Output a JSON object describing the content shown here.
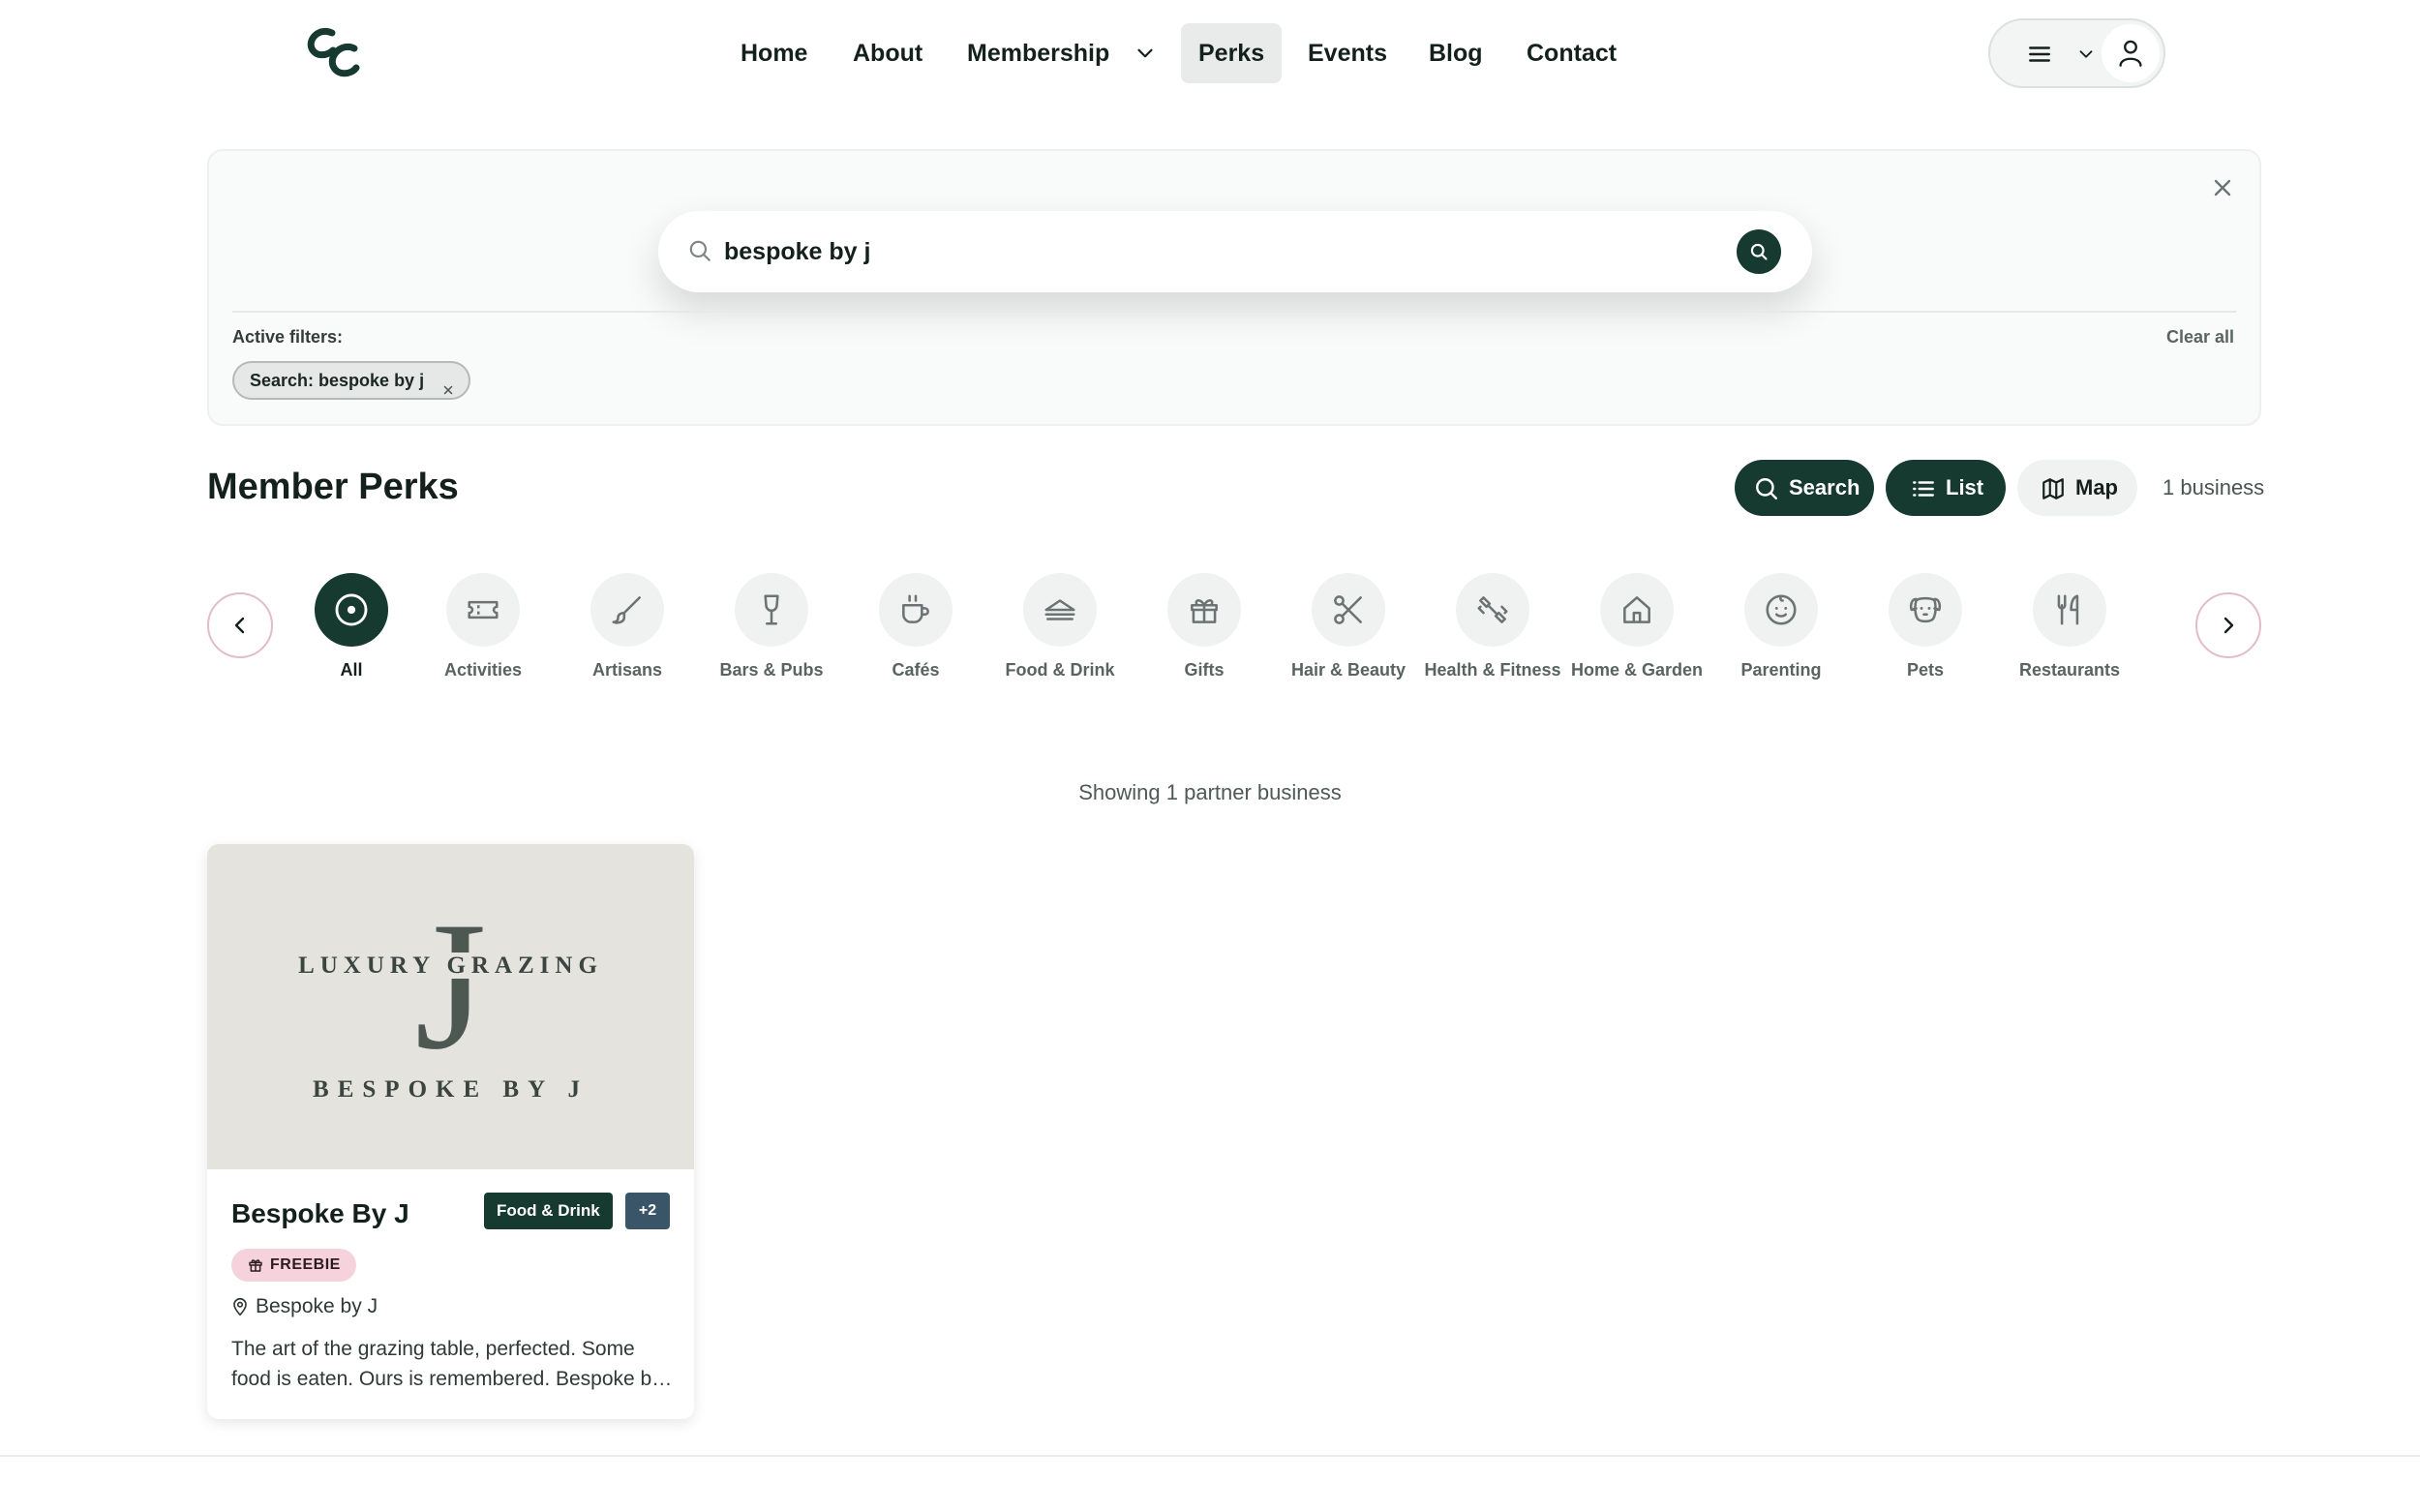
{
  "brand": {
    "logo_text": "cc"
  },
  "nav": {
    "items": [
      {
        "label": "Home"
      },
      {
        "label": "About"
      },
      {
        "label": "Membership"
      },
      {
        "label": "Perks"
      },
      {
        "label": "Events"
      },
      {
        "label": "Blog"
      },
      {
        "label": "Contact"
      }
    ],
    "active": "Perks"
  },
  "search": {
    "value": "bespoke by j",
    "active_filters_label": "Active filters:",
    "clear_all_label": "Clear all",
    "chip_label": "Search: bespoke by j"
  },
  "perks": {
    "title": "Member Perks",
    "search_button": "Search",
    "list_button": "List",
    "map_button": "Map",
    "business_count": "1 business"
  },
  "categories": [
    {
      "label": "All",
      "icon": "target-icon",
      "selected": true
    },
    {
      "label": "Activities",
      "icon": "ticket-icon"
    },
    {
      "label": "Artisans",
      "icon": "brush-icon"
    },
    {
      "label": "Bars & Pubs",
      "icon": "wine-glass-icon"
    },
    {
      "label": "Cafés",
      "icon": "coffee-cup-icon"
    },
    {
      "label": "Food & Drink",
      "icon": "sandwich-icon"
    },
    {
      "label": "Gifts",
      "icon": "gift-icon"
    },
    {
      "label": "Hair & Beauty",
      "icon": "scissors-icon"
    },
    {
      "label": "Health & Fitness",
      "icon": "dumbbell-icon"
    },
    {
      "label": "Home & Garden",
      "icon": "house-icon"
    },
    {
      "label": "Parenting",
      "icon": "baby-icon"
    },
    {
      "label": "Pets",
      "icon": "dog-icon"
    },
    {
      "label": "Restaurants",
      "icon": "utensils-icon"
    }
  ],
  "results": {
    "showing_text": "Showing 1 partner business"
  },
  "card": {
    "image_top_text": "LUXURY GRAZING",
    "image_letter": "J",
    "image_bottom_text": "BESPOKE BY J",
    "name": "Bespoke By J",
    "category_tag": "Food & Drink",
    "more_tag": "+2",
    "badge": "FREEBIE",
    "location": "Bespoke by J",
    "description": "The art of the grazing table, perfected. Some food is eaten. Ours is remembered. Bespoke by J creates grazing tables for every occasion."
  },
  "colors": {
    "brand_dark": "#163a2f",
    "freebie_pink": "#f6d3dc",
    "tag_slate": "#3a5568"
  }
}
